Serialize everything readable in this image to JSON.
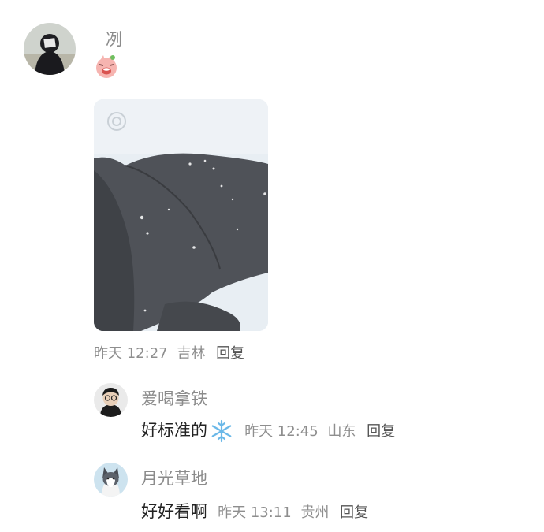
{
  "main_comment": {
    "username": "冽",
    "sticker_icon": "pig-laughing-sticker-icon",
    "photo_description_icon": "snow-on-sleeve-photo",
    "time": "昨天 12:27",
    "location": "吉林",
    "reply_label": "回复"
  },
  "replies": [
    {
      "username": "爱喝拿铁",
      "text": "好标准的",
      "emoji": "❄️",
      "time": "昨天 12:45",
      "location": "山东",
      "reply_label": "回复"
    },
    {
      "username": "月光草地",
      "text": "好好看啊",
      "time": "昨天 13:11",
      "location": "贵州",
      "reply_label": "回复"
    }
  ],
  "colors": {
    "name_gray": "#8b8b8b",
    "meta_gray": "#8e8e8e",
    "text_dark": "#222222",
    "sticker_pink": "#f4a2a2"
  }
}
